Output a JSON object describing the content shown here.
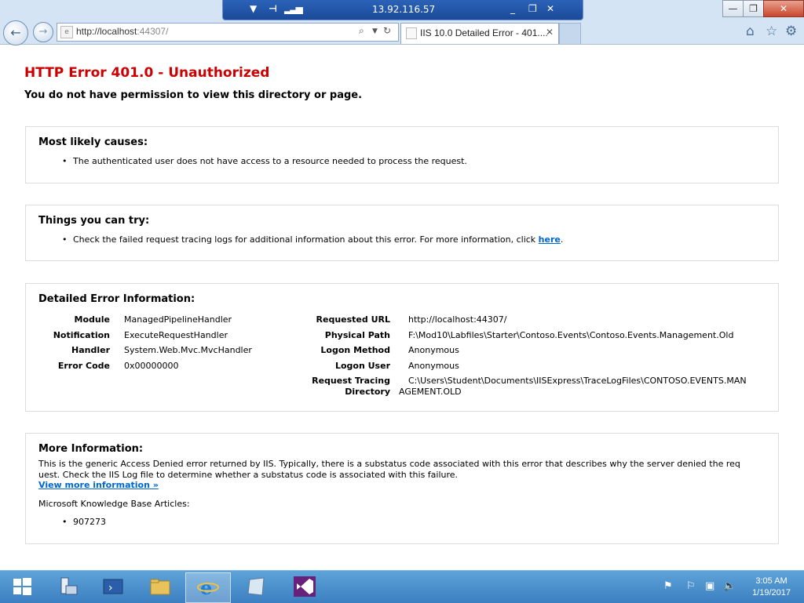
{
  "rdp": {
    "title": "13.92.116.57"
  },
  "browser": {
    "address": {
      "prefix": "http://localhost",
      "port": ":44307/"
    },
    "tab": {
      "title": "IIS 10.0 Detailed Error - 401...."
    }
  },
  "page": {
    "title": "HTTP Error 401.0 - Unauthorized",
    "subtitle": "You do not have permission to view this directory or page.",
    "causes": {
      "heading": "Most likely causes:",
      "items": [
        "The authenticated user does not have access to a resource needed to process the request."
      ]
    },
    "try": {
      "heading": "Things you can try:",
      "text": "Check the failed request tracing logs for additional information about this error. For more information, click ",
      "link": "here",
      "suffix": "."
    },
    "detail": {
      "heading": "Detailed Error Information:",
      "left": [
        {
          "label": "Module",
          "value": "ManagedPipelineHandler"
        },
        {
          "label": "Notification",
          "value": "ExecuteRequestHandler"
        },
        {
          "label": "Handler",
          "value": "System.Web.Mvc.MvcHandler"
        },
        {
          "label": "Error Code",
          "value": "0x00000000"
        }
      ],
      "right": [
        {
          "label": "Requested URL",
          "value": "http://localhost:44307/"
        },
        {
          "label": "Physical Path",
          "value": "F:\\Mod10\\Labfiles\\Starter\\Contoso.Events\\Contoso.Events.Management.Old"
        },
        {
          "label": "Logon Method",
          "value": "Anonymous"
        },
        {
          "label": "Logon User",
          "value": "Anonymous"
        },
        {
          "label_line1": "Request Tracing",
          "label_line2": "Directory",
          "value_line1": "C:\\Users\\Student\\Documents\\IISExpress\\TraceLogFiles\\CONTOSO.EVENTS.MAN",
          "value_line2": "AGEMENT.OLD"
        }
      ]
    },
    "more": {
      "heading": "More Information:",
      "text_line1": "This is the generic Access Denied error returned by IIS. Typically, there is a substatus code associated with this error that describes why the server denied the req",
      "text_line2": "uest. Check the IIS Log file to determine whether a substatus code is associated with this failure.",
      "link": "View more information »",
      "kb_label": "Microsoft Knowledge Base Articles:",
      "kb_items": [
        "907273"
      ]
    }
  },
  "taskbar": {
    "time": "3:05 AM",
    "date": "1/19/2017"
  },
  "colors": {
    "error_red": "#cc0000",
    "link_blue": "#0066cc",
    "taskbar_blue": "#3b7fc0"
  }
}
